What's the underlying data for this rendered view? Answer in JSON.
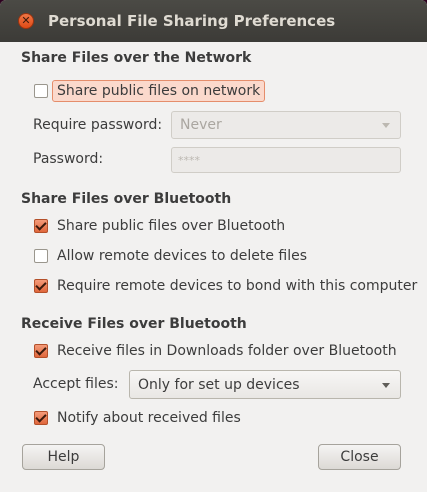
{
  "window": {
    "title": "Personal File Sharing Preferences",
    "close_icon": "close-icon"
  },
  "network": {
    "heading": "Share Files over the Network",
    "share_public": {
      "label": "Share public files on network",
      "checked": false
    },
    "require_password": {
      "label": "Require password:",
      "value": "Never"
    },
    "password": {
      "label": "Password:",
      "value": "****"
    }
  },
  "bluetooth_share": {
    "heading": "Share Files over Bluetooth",
    "options": [
      {
        "label": "Share public files over Bluetooth",
        "checked": true
      },
      {
        "label": "Allow remote devices to delete files",
        "checked": false
      },
      {
        "label": "Require remote devices to bond with this computer",
        "checked": true
      }
    ]
  },
  "bluetooth_receive": {
    "heading": "Receive Files over Bluetooth",
    "receive_downloads": {
      "label": "Receive files in Downloads folder over Bluetooth",
      "checked": true
    },
    "accept_files": {
      "label": "Accept files:",
      "value": "Only for set up devices"
    },
    "notify": {
      "label": "Notify about received files",
      "checked": true
    }
  },
  "buttons": {
    "help": "Help",
    "close": "Close"
  },
  "colors": {
    "accent": "#e0673c",
    "titlebar": "#3c3b37",
    "background": "#f2f1f0"
  }
}
